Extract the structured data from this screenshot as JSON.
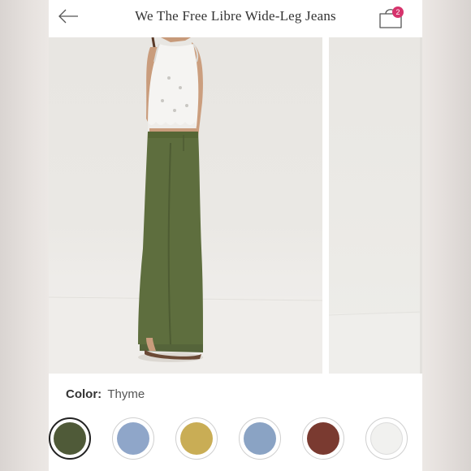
{
  "header": {
    "title": "We The Free Libre Wide-Leg Jeans",
    "cart_count": "2",
    "back_icon": "arrow-left-icon",
    "bag_icon": "shopping-bag-icon"
  },
  "product": {
    "color_label": "Color:",
    "selected_color": "Thyme"
  },
  "swatches": [
    {
      "color": "#4f5a38",
      "selected": true
    },
    {
      "color": "#8fa6c9",
      "selected": false
    },
    {
      "color": "#c9ad55",
      "selected": false
    },
    {
      "color": "#8aa3c4",
      "selected": false
    },
    {
      "color": "#7a3a30",
      "selected": false
    },
    {
      "color": "#f1f1ef",
      "selected": false
    }
  ],
  "colors": {
    "badge": "#d6336c",
    "jeans": "#5e6e3e",
    "background": "#ffffff"
  }
}
